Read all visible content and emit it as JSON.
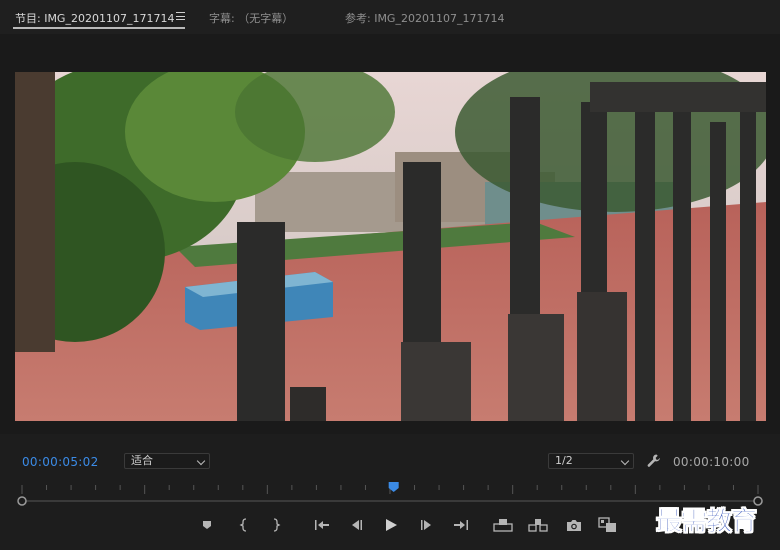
{
  "tabs": [
    {
      "label": "节目: IMG_20201107_171714",
      "active": true
    },
    {
      "label": "字幕: （无字幕）",
      "active": false
    },
    {
      "label": "参考: IMG_20201107_171714",
      "active": false
    }
  ],
  "icons": {
    "panel_menu": "hamburger-menu-icon",
    "settings": "wrench-icon"
  },
  "timecodes": {
    "current": "00:00:05:02",
    "duration": "00:00:10:00"
  },
  "zoom_select": {
    "value": "适合"
  },
  "resolution_select": {
    "value": "1/2"
  },
  "playhead": {
    "position_fraction": 0.505
  },
  "transport_buttons": [
    "add-marker-button",
    "mark-in-button",
    "mark-out-button",
    "go-to-in-button",
    "step-back-button",
    "play-button",
    "step-forward-button",
    "go-to-out-button",
    "lift-button",
    "extract-button",
    "export-frame-button",
    "comparison-view-button"
  ],
  "colors": {
    "accent": "#3b8be6",
    "background": "#1d1d1d"
  },
  "watermark": "最需教育"
}
